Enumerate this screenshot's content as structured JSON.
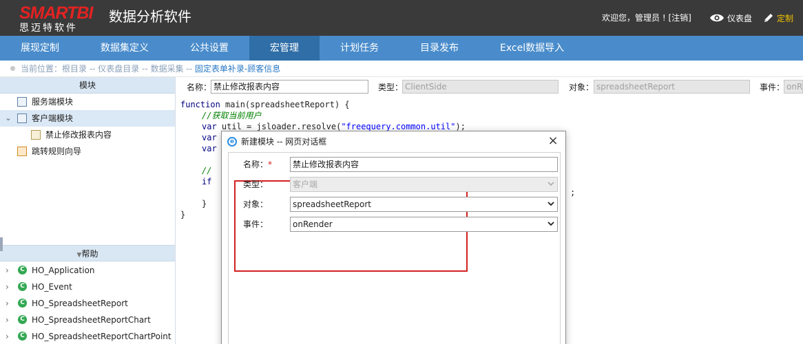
{
  "header": {
    "logo_top": "SMARTBI",
    "logo_bottom": "思迈特软件",
    "app_title": "数据分析软件",
    "welcome": "欢迎您，管理员 ! [",
    "logout": "注销",
    "welcome_tail": "]",
    "dashboard_label": "仪表盘",
    "custom_label": "定制"
  },
  "nav": {
    "items": [
      "展现定制",
      "数据集定义",
      "公共设置",
      "宏管理",
      "计划任务",
      "目录发布",
      "Excel数据导入"
    ],
    "active_index": 3
  },
  "breadcrumb": {
    "prefix": "当前位置：",
    "path": "根目录 -- 仪表盘目录 -- 数据采集 -- ",
    "current": "固定表单补录-顾客信息"
  },
  "module_panel": {
    "title": "模块",
    "items": [
      {
        "label": "服务端模块",
        "icon": "server-module-icon"
      },
      {
        "label": "客户端模块",
        "icon": "client-module-icon",
        "expanded": true,
        "selected": true
      },
      {
        "label": "禁止修改报表内容",
        "icon": "js-module-icon",
        "child": true
      },
      {
        "label": "跳转规则向导",
        "icon": "jump-rule-icon"
      }
    ]
  },
  "help_panel": {
    "title": "帮助",
    "items": [
      "HO_Application",
      "HO_Event",
      "HO_SpreadsheetReport",
      "HO_SpreadsheetReportChart",
      "HO_SpreadsheetReportChartPoint"
    ]
  },
  "props": {
    "name_label": "名称：",
    "name_value": "禁止修改报表内容",
    "type_label": "类型：",
    "type_value": "ClientSide",
    "object_label": "对象：",
    "object_value": "spreadsheetReport",
    "event_label": "事件：",
    "event_value": "onRe"
  },
  "code": {
    "line1_kw": "function",
    "line1_rest": " main(spreadsheetReport) {",
    "line2_comment": "//获取当前用户",
    "line3_kw": "var",
    "line3_rest": " util = jsloader.resolve(",
    "line3_str": "\"freequery.common.util\"",
    "line3_tail": ");",
    "line4_kw": "var",
    "line5_kw": "var",
    "line6_comment": "// ",
    "line7_kw": "if",
    "line7_tail": ";",
    "line8": "}",
    "line9": "}"
  },
  "dialog": {
    "title": "新建模块 -- 网页对话框",
    "close": "×",
    "name_label": "名称：",
    "name_required": "*",
    "name_value": "禁止修改报表内容",
    "type_label": "类型：",
    "type_value": "客户端",
    "object_label": "对象：",
    "object_value": "spreadsheetReport",
    "event_label": "事件：",
    "event_value": "onRender"
  },
  "colors": {
    "header_bg": "#3a3a3a",
    "nav_bg": "#4a8ccb",
    "nav_active": "#2f6ea7",
    "logo_red": "#e32222",
    "highlight_red": "#d32020",
    "custom_yellow": "#f2c200"
  }
}
